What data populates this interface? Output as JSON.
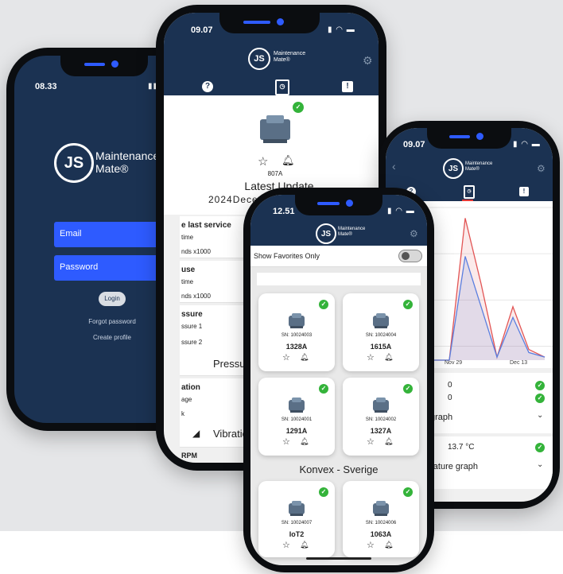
{
  "colors": {
    "navy": "#1b3252",
    "blue": "#2e5bff",
    "green": "#34b33a",
    "red_line": "#e25555",
    "blue_line": "#5a7fe0"
  },
  "phone1": {
    "time": "08.33",
    "brand_line1": "Maintenance",
    "brand_line2": "Mate®",
    "logo_letters": "JS",
    "email_placeholder": "Email",
    "password_placeholder": "Password",
    "login_label": "Login",
    "forgot_label": "Forgot password",
    "create_label": "Create profile"
  },
  "phone2": {
    "time": "09.07",
    "brand_line1": "Maintenance",
    "brand_line2": "Mate®",
    "logo_letters": "JS",
    "product_name": "807A",
    "latest_update": "Latest Update",
    "latest_date": "2024Decem",
    "rows": [
      {
        "title": "e last service",
        "l1": "time",
        "l2": "nds x1000"
      },
      {
        "title": "use",
        "l1": "time",
        "l2": "nds x1000"
      },
      {
        "title": "ssure",
        "l1": "ssure 1",
        "l2": "ssure 2"
      }
    ],
    "pressure_label": "Pressure",
    "vibration_title": "ation",
    "vibration_l1": "age",
    "vibration_l2": "k",
    "vibration_label": "Vibration",
    "rpm_label": "RPM"
  },
  "phone3": {
    "time": "09.07",
    "brand_line1": "Maintenance",
    "brand_line2": "Mate®",
    "logo_letters": "JS",
    "x_ticks": [
      "Nov 29",
      "Dec 13"
    ],
    "value_1": "0",
    "value_2": "0",
    "graph_label": "graph",
    "temp_value": "13.7 °C",
    "temp_graph_label": "erature graph"
  },
  "chart_data": {
    "type": "area",
    "x": [
      "",
      "",
      "",
      "",
      "Nov 29",
      "",
      "",
      "Dec 13"
    ],
    "series": [
      {
        "values": [
          0.0,
          0.0,
          0.93,
          0.5,
          0.02,
          0.35,
          0.07,
          0.02
        ]
      },
      {
        "values": [
          0.0,
          0.0,
          0.68,
          0.35,
          0.02,
          0.28,
          0.05,
          0.02
        ]
      }
    ]
  },
  "phone4": {
    "time": "12.51",
    "brand_line1": "Maintenance",
    "brand_line2": "Mate®",
    "logo_letters": "JS",
    "show_favorites": "Show Favorites Only",
    "group_label": "Konvex - Sverige",
    "cards": [
      {
        "sn": "SN: 10024003",
        "name": "1328A"
      },
      {
        "sn": "SN: 10024004",
        "name": "1615A"
      },
      {
        "sn": "SN: 10024001",
        "name": "1291A"
      },
      {
        "sn": "SN: 10024002",
        "name": "1327A"
      },
      {
        "sn": "SN: 10024007",
        "name": "IoT2"
      },
      {
        "sn": "SN: 10024006",
        "name": "1063A"
      }
    ]
  }
}
